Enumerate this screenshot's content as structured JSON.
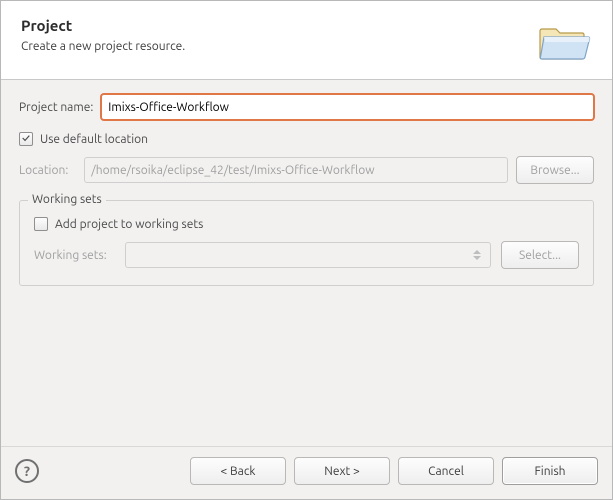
{
  "header": {
    "title": "Project",
    "subtitle": "Create a new project resource."
  },
  "form": {
    "project_name_label": "Project name:",
    "project_name_value": "Imixs-Office-Workflow",
    "use_default_location_label": "Use default location",
    "location_label": "Location:",
    "location_value": "/home/rsoika/eclipse_42/test/Imixs-Office-Workflow",
    "browse_label": "Browse..."
  },
  "working_sets": {
    "legend": "Working sets",
    "add_label": "Add project to working sets",
    "combo_label": "Working sets:",
    "select_label": "Select..."
  },
  "footer": {
    "back": "< Back",
    "next": "Next >",
    "cancel": "Cancel",
    "finish": "Finish"
  }
}
